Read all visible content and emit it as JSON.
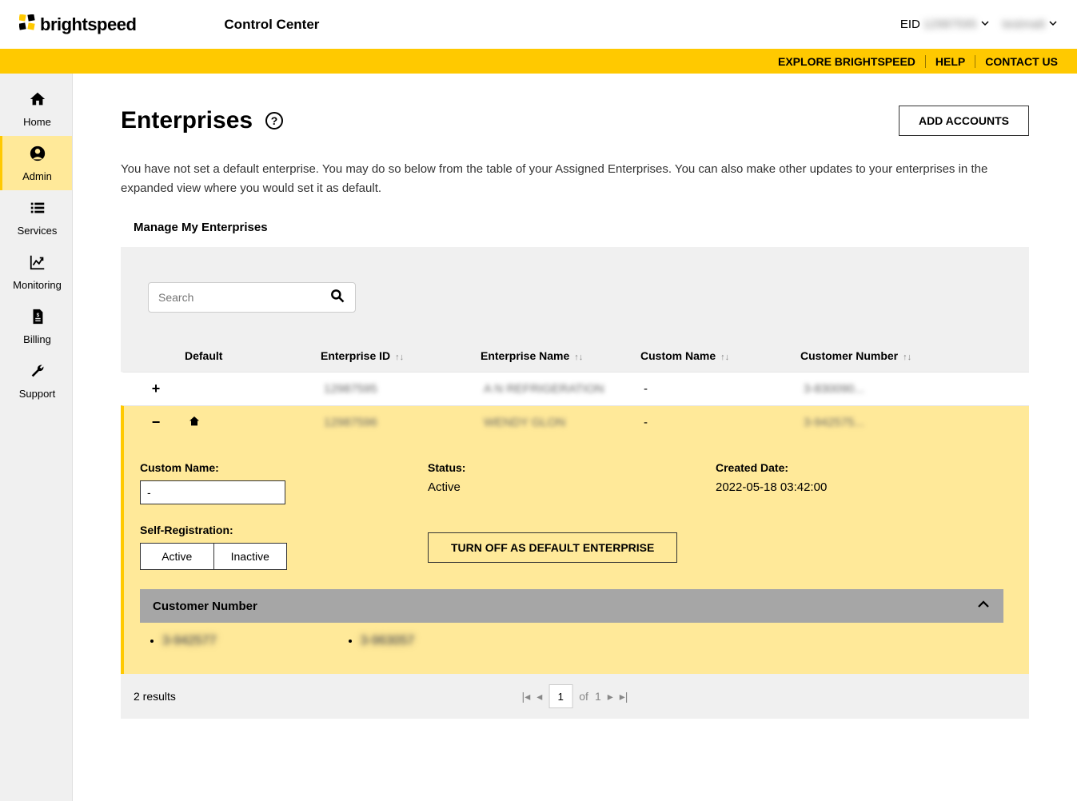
{
  "brand": "brightspeed",
  "app_title": "Control Center",
  "header": {
    "eid_label": "EID",
    "eid_value": "12987595",
    "username": "testmatt"
  },
  "top_links": {
    "explore": "EXPLORE BRIGHTSPEED",
    "help": "HELP",
    "contact": "CONTACT US"
  },
  "sidebar": [
    {
      "label": "Home",
      "name": "sidebar-item-home",
      "active": false
    },
    {
      "label": "Admin",
      "name": "sidebar-item-admin",
      "active": true
    },
    {
      "label": "Services",
      "name": "sidebar-item-services",
      "active": false
    },
    {
      "label": "Monitoring",
      "name": "sidebar-item-monitoring",
      "active": false
    },
    {
      "label": "Billing",
      "name": "sidebar-item-billing",
      "active": false
    },
    {
      "label": "Support",
      "name": "sidebar-item-support",
      "active": false
    }
  ],
  "page": {
    "title": "Enterprises",
    "add_accounts": "ADD ACCOUNTS",
    "description": "You have not set a default enterprise. You may do so below from the table of your Assigned Enterprises. You can also make other updates to your enterprises in the expanded view where you would set it as default."
  },
  "section_title": "Manage My Enterprises",
  "search": {
    "placeholder": "Search"
  },
  "columns": {
    "default": "Default",
    "eid": "Enterprise ID",
    "ename": "Enterprise Name",
    "custom": "Custom Name",
    "cust": "Customer Number"
  },
  "rows": [
    {
      "expanded": false,
      "default": false,
      "eid": "12987595",
      "ename": "A N REFRIGERATION",
      "custom": "-",
      "cust": "3-830090..."
    },
    {
      "expanded": true,
      "default": true,
      "eid": "12987596",
      "ename": "WENDY GLON",
      "custom": "-",
      "cust": "3-942575..."
    }
  ],
  "expanded": {
    "custom_name_label": "Custom Name:",
    "custom_name_value": "-",
    "status_label": "Status:",
    "status_value": "Active",
    "created_label": "Created Date:",
    "created_value": "2022-05-18 03:42:00",
    "self_reg_label": "Self-Registration:",
    "self_reg_active": "Active",
    "self_reg_inactive": "Inactive",
    "turn_off": "TURN OFF AS DEFAULT ENTERPRISE",
    "customer_number_header": "Customer Number",
    "customer_numbers": [
      "3-942577",
      "3-963057"
    ]
  },
  "footer": {
    "results": "2 results",
    "page": "1",
    "of": "of",
    "total": "1"
  }
}
